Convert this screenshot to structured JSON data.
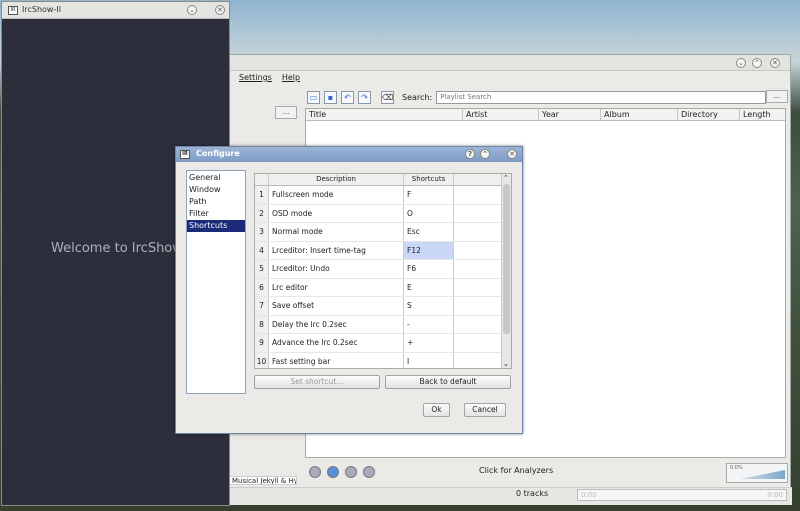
{
  "player": {
    "menu": [
      "Settings",
      "Help"
    ],
    "search_label": "Search:",
    "search_placeholder": "Playlist Search",
    "dots_label": "...",
    "columns": [
      "Title",
      "Artist",
      "Year",
      "Album",
      "Directory",
      "Length"
    ],
    "analyzer_text": "Click for Analyzers",
    "tracks_text": "0 tracks",
    "time_left": "0:00",
    "time_right": "0:00",
    "volume_text": "0.0%",
    "list_fragment": "Musical Jekyll & Hyde Broadway"
  },
  "ircshow": {
    "title": "IrcShow-II",
    "welcome": "Welcome to IrcShow-II"
  },
  "dialog": {
    "title": "Configure",
    "categories": [
      "General",
      "Window",
      "Path",
      "Filter",
      "Shortcuts"
    ],
    "selected_category": "Shortcuts",
    "table_headers": {
      "description": "Description",
      "shortcuts": "Shortcuts"
    },
    "rows": [
      {
        "num": "1",
        "desc": "Fullscreen mode",
        "key": "F"
      },
      {
        "num": "2",
        "desc": "OSD mode",
        "key": "O"
      },
      {
        "num": "3",
        "desc": "Normal mode",
        "key": "Esc"
      },
      {
        "num": "4",
        "desc": "Lrceditor: Insert time-tag",
        "key": "F12"
      },
      {
        "num": "5",
        "desc": "Lrceditor: Undo",
        "key": "F6"
      },
      {
        "num": "6",
        "desc": "Lrc editor",
        "key": "E"
      },
      {
        "num": "7",
        "desc": "Save offset",
        "key": "S"
      },
      {
        "num": "8",
        "desc": "Delay the lrc 0.2sec",
        "key": "-"
      },
      {
        "num": "9",
        "desc": "Advance the lrc 0.2sec",
        "key": "+"
      },
      {
        "num": "10",
        "desc": "Fast setting bar",
        "key": "I"
      }
    ],
    "selected_row_index": 3,
    "set_shortcut_label": "Set shortcut...",
    "back_default_label": "Back to default",
    "ok_label": "Ok",
    "cancel_label": "Cancel"
  }
}
